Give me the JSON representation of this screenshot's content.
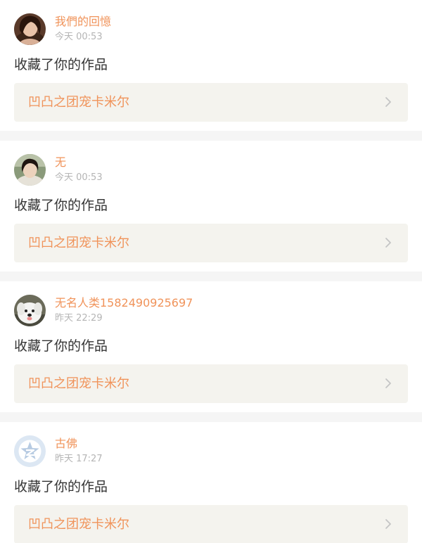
{
  "colors": {
    "accent": "#f0935a",
    "link_bg": "#f4f3ee",
    "chevron": "#c4c4c4"
  },
  "feed": {
    "items": [
      {
        "username": "我們的回憶",
        "time": "今天 00:53",
        "action": "收藏了你的作品",
        "work_title": "凹凸之团宠卡米尔",
        "avatar_icon": "avatar-photo-woman-dark-hair"
      },
      {
        "username": "无",
        "time": "今天 00:53",
        "action": "收藏了你的作品",
        "work_title": "凹凸之团宠卡米尔",
        "avatar_icon": "avatar-photo-girl"
      },
      {
        "username": "无名人类1582490925697",
        "time": "昨天 22:29",
        "action": "收藏了你的作品",
        "work_title": "凹凸之团宠卡米尔",
        "avatar_icon": "avatar-photo-white-dog"
      },
      {
        "username": "古佛",
        "time": "昨天 17:27",
        "action": "收藏了你的作品",
        "work_title": "凹凸之团宠卡米尔",
        "avatar_icon": "avatar-default-qzone-star"
      }
    ]
  }
}
